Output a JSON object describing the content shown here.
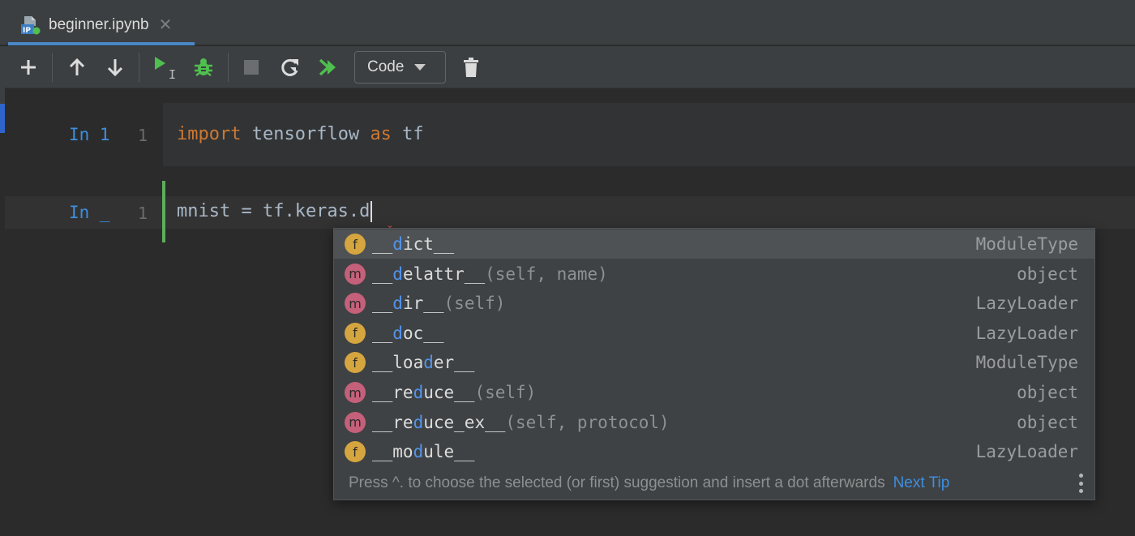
{
  "tab": {
    "title": "beginner.ipynb",
    "icon_badge": "IP"
  },
  "toolbar": {
    "add": "add-icon",
    "move_up": "arrow-up-icon",
    "move_down": "arrow-down-icon",
    "run": "run-icon",
    "run_cursor_text": "I",
    "debug": "bug-icon",
    "stop": "stop-icon",
    "restart": "restart-icon",
    "run_all": "run-all-icon",
    "cell_type": "Code",
    "delete": "trash-icon"
  },
  "cells": [
    {
      "prompt": "In 1",
      "line": "1",
      "tokens": [
        {
          "t": "import",
          "k": true
        },
        {
          "t": " tensorflow ",
          "k": false
        },
        {
          "t": "as",
          "k": true
        },
        {
          "t": " tf",
          "k": false
        }
      ]
    },
    {
      "prompt": "In _",
      "line": "1",
      "code": "mnist = tf.keras.d"
    }
  ],
  "completion": {
    "items": [
      {
        "kind": "f",
        "pre": "__",
        "hl": "d",
        "post": "ict__",
        "params": "",
        "type": "ModuleType",
        "selected": true
      },
      {
        "kind": "m",
        "pre": "__",
        "hl": "d",
        "post": "elattr__",
        "params": "(self, name)",
        "type": "object"
      },
      {
        "kind": "m",
        "pre": "__",
        "hl": "d",
        "post": "ir__",
        "params": "(self)",
        "type": "LazyLoader"
      },
      {
        "kind": "f",
        "pre": "__",
        "hl": "d",
        "post": "oc__",
        "params": "",
        "type": "LazyLoader"
      },
      {
        "kind": "f",
        "pre": "__loa",
        "hl": "d",
        "post": "er__",
        "params": "",
        "type": "ModuleType"
      },
      {
        "kind": "m",
        "pre": "__re",
        "hl": "d",
        "post": "uce__",
        "params": "(self)",
        "type": "object"
      },
      {
        "kind": "m",
        "pre": "__re",
        "hl": "d",
        "post": "uce_ex__",
        "params": "(self, protocol)",
        "type": "object"
      },
      {
        "kind": "f",
        "pre": "__mo",
        "hl": "d",
        "post": "ule__",
        "params": "",
        "type": "LazyLoader"
      }
    ],
    "footer_text": "Press ^. to choose the selected (or first) suggestion and insert a dot afterwards",
    "next_tip": "Next Tip",
    "more_icon": "vertical-dots-icon"
  },
  "colors": {
    "accent": "#4a88c7",
    "keyword": "#cc7832",
    "run_green": "#4fbf4f",
    "active_cell": "#5eac5d",
    "badge_f": "#d5a53f",
    "badge_m": "#c5607a"
  }
}
